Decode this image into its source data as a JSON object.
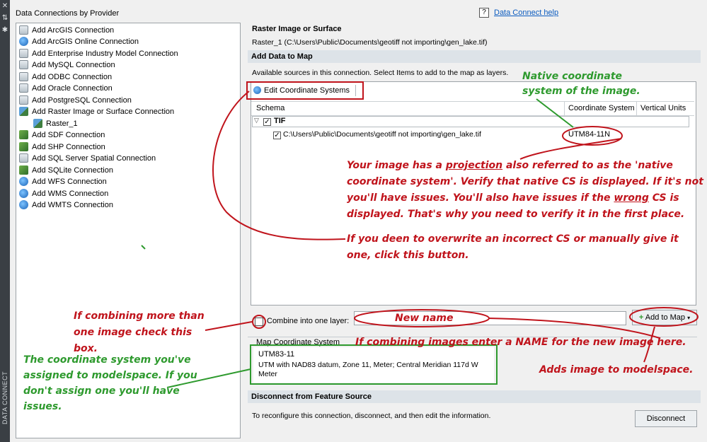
{
  "side_strip": {
    "label": "DATA CONNECT"
  },
  "left_panel": {
    "title": "Data Connections by Provider",
    "providers": [
      {
        "label": "Add ArcGIS Connection",
        "icon": "db-icon"
      },
      {
        "label": "Add ArcGIS Online Connection",
        "icon": "globe-icon"
      },
      {
        "label": "Add Enterprise Industry Model Connection",
        "icon": "db-icon"
      },
      {
        "label": "Add MySQL Connection",
        "icon": "db-icon"
      },
      {
        "label": "Add ODBC Connection",
        "icon": "db-icon"
      },
      {
        "label": "Add Oracle Connection",
        "icon": "db-icon"
      },
      {
        "label": "Add PostgreSQL Connection",
        "icon": "db-icon"
      },
      {
        "label": "Add Raster Image or Surface Connection",
        "icon": "raster-icon"
      },
      {
        "label": "Raster_1",
        "icon": "raster-icon"
      },
      {
        "label": "Add SDF Connection",
        "icon": "sdf-icon"
      },
      {
        "label": "Add SHP Connection",
        "icon": "sdf-icon"
      },
      {
        "label": "Add SQL Server Spatial Connection",
        "icon": "db-icon"
      },
      {
        "label": "Add SQLite Connection",
        "icon": "sdf-icon"
      },
      {
        "label": "Add WFS Connection",
        "icon": "globe-icon"
      },
      {
        "label": "Add WMS Connection",
        "icon": "globe-icon"
      },
      {
        "label": "Add WMTS Connection",
        "icon": "globe-icon"
      }
    ]
  },
  "help": {
    "icon_text": "?",
    "link": "Data Connect help"
  },
  "raster_header": {
    "title": "Raster Image or Surface",
    "path": "Raster_1 (C:\\Users\\Public\\Documents\\geotiff not importing\\gen_lake.tif)"
  },
  "add_data": {
    "section_title": "Add Data to Map",
    "description": "Available sources in this connection.  Select Items to add to the map as layers.",
    "edit_cs_button": "Edit Coordinate Systems",
    "columns": [
      "Schema",
      "Coordinate System",
      "Vertical Units"
    ],
    "group_label": "TIF",
    "file_path": "C:\\Users\\Public\\Documents\\geotiff not importing\\gen_lake.tif",
    "file_cs": "UTM84-11N",
    "combine_label": "Combine into one layer:",
    "add_to_map_button": "Add to Map"
  },
  "map_cs": {
    "label": "Map Coordinate System",
    "code": "UTM83-11",
    "description": "UTM with NAD83 datum, Zone 11, Meter; Central Meridian 117d W Meter"
  },
  "disconnect": {
    "section_title": "Disconnect from Feature Source",
    "description": "To reconfigure this connection, disconnect, and then edit the information.",
    "button": "Disconnect"
  },
  "annotations": {
    "native": [
      "Native coordinate",
      "system of the image."
    ],
    "projection_html_parts": [
      "Your image has a ",
      "projection",
      " also referred to as the 'native coordinate system'. Verify that native CS is displayed. If it's not you'll have issues. You'll also have issues if the ",
      "wrong",
      " CS is displayed. That's why you need to verify it in the first place."
    ],
    "overwrite": "If you deen to overwrite an incorrect CS or manually give it one, click this button.",
    "combine": "If combining more than one image check this box.",
    "new_name": "New name",
    "enter_name": "If combining images enter a NAME for the new  image here.",
    "modelspace": "The coordinate system you've assigned to modelspace. If you don't assign one you'll have issues.",
    "adds": "Adds image to modelspace."
  },
  "colors": {
    "annotation_red": "#c0141c",
    "annotation_green": "#2e9a2e",
    "link_blue": "#0b5bbf"
  }
}
